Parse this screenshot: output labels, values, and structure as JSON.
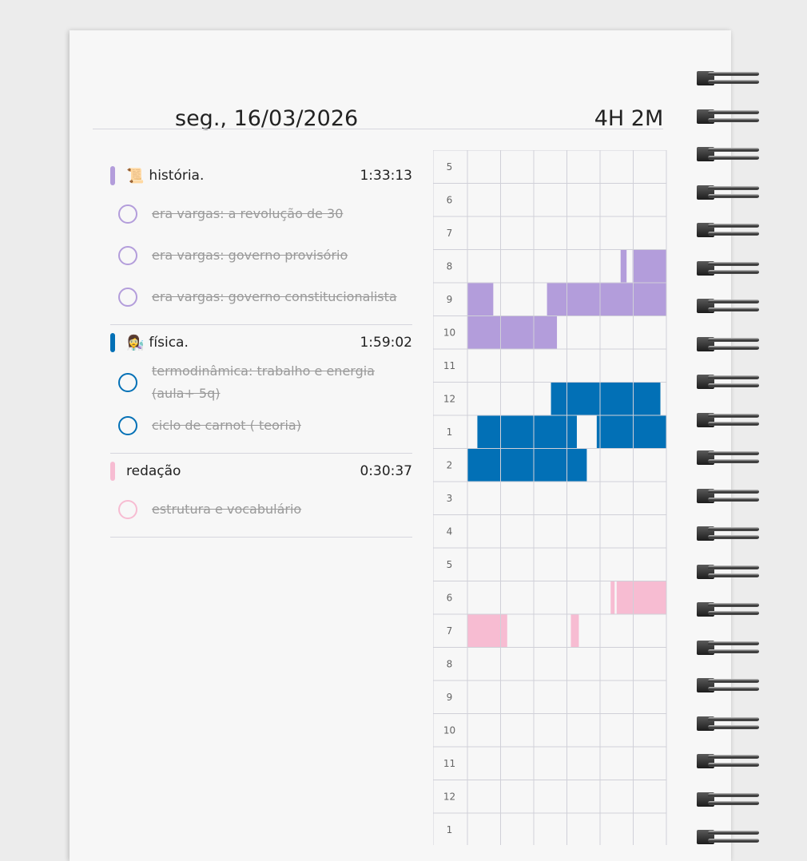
{
  "header": {
    "date": "seg., 16/03/2026",
    "total": "4H 2M"
  },
  "subjects": [
    {
      "icon": "scroll-emoji",
      "emoji": "📜",
      "name": "história.",
      "time": "1:33:13",
      "color": "#b39ddb",
      "tasks": [
        {
          "label": "era vargas: a revolução de 30",
          "done": true
        },
        {
          "label": "era vargas: governo provisório",
          "done": true
        },
        {
          "label": "era vargas: governo constitucionalista",
          "done": true
        }
      ]
    },
    {
      "icon": "scientist-emoji",
      "emoji": "👩‍🔬",
      "name": "física.",
      "time": "1:59:02",
      "color": "#0270b6",
      "tasks": [
        {
          "label": "termodinâmica: trabalho e energia (aula+ 5q)",
          "done": true
        },
        {
          "label": "ciclo de carnot ( teoria)",
          "done": true
        }
      ]
    },
    {
      "icon": "",
      "emoji": "",
      "name": "redação",
      "time": "0:30:37",
      "color": "#f7bcd2",
      "tasks": [
        {
          "label": "estrutura e vocabulário",
          "done": true
        }
      ]
    }
  ],
  "timeline": {
    "hour_labels": [
      "5",
      "6",
      "7",
      "8",
      "9",
      "10",
      "11",
      "12",
      "1",
      "2",
      "3",
      "4",
      "5",
      "6",
      "7",
      "8",
      "9",
      "10",
      "11",
      "12",
      "1"
    ],
    "columns_per_hour": 6,
    "blocks": [
      {
        "subject": "história.",
        "color": "#b39ddb",
        "hour": 3,
        "start": 0.77,
        "end": 0.8
      },
      {
        "subject": "história.",
        "color": "#b39ddb",
        "hour": 3,
        "start": 0.83,
        "end": 1.0
      },
      {
        "subject": "história.",
        "color": "#b39ddb",
        "hour": 4,
        "start": 0.0,
        "end": 0.13
      },
      {
        "subject": "história.",
        "color": "#b39ddb",
        "hour": 4,
        "start": 0.4,
        "end": 1.0
      },
      {
        "subject": "história.",
        "color": "#b39ddb",
        "hour": 5,
        "start": 0.0,
        "end": 0.45
      },
      {
        "subject": "física.",
        "color": "#0270b6",
        "hour": 7,
        "start": 0.42,
        "end": 0.97
      },
      {
        "subject": "física.",
        "color": "#0270b6",
        "hour": 8,
        "start": 0.05,
        "end": 0.55
      },
      {
        "subject": "física.",
        "color": "#0270b6",
        "hour": 8,
        "start": 0.65,
        "end": 1.0
      },
      {
        "subject": "física.",
        "color": "#0270b6",
        "hour": 9,
        "start": 0.0,
        "end": 0.6
      },
      {
        "subject": "redação",
        "color": "#f7bcd2",
        "hour": 13,
        "start": 0.72,
        "end": 0.74
      },
      {
        "subject": "redação",
        "color": "#f7bcd2",
        "hour": 13,
        "start": 0.75,
        "end": 1.0
      },
      {
        "subject": "redação",
        "color": "#f7bcd2",
        "hour": 14,
        "start": 0.0,
        "end": 0.2
      },
      {
        "subject": "redação",
        "color": "#f7bcd2",
        "hour": 14,
        "start": 0.52,
        "end": 0.56
      }
    ]
  }
}
